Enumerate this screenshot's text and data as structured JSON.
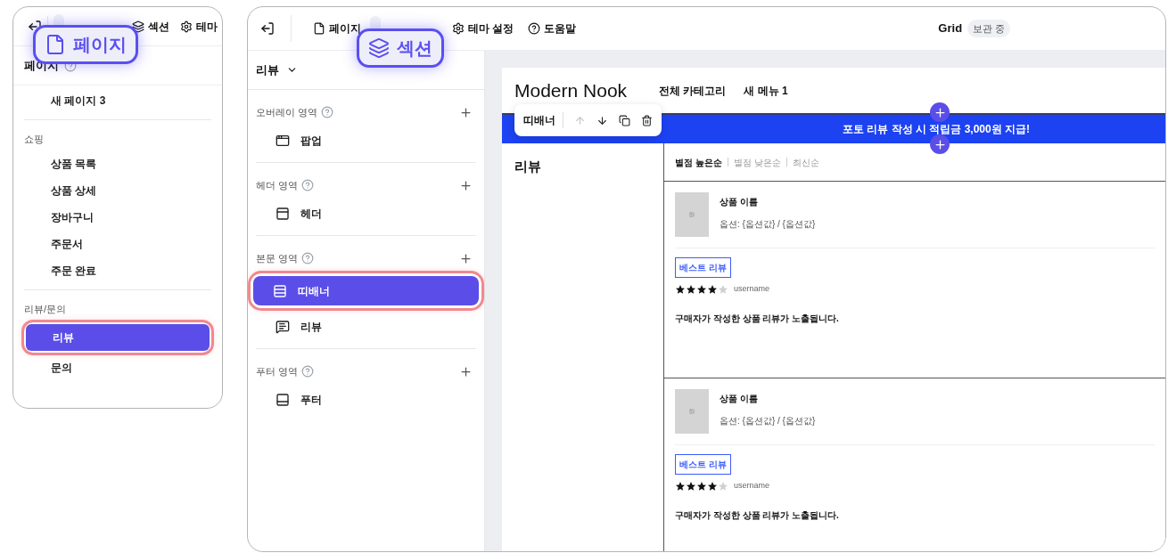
{
  "pages_panel": {
    "tabs": [
      {
        "kind": "page",
        "selected": true
      },
      {
        "label": "섹션",
        "kind": "section",
        "selected": false
      },
      {
        "label": "테마",
        "kind": "theme",
        "selected": false
      }
    ],
    "callout": {
      "label": "페이지",
      "kind": "page"
    },
    "heading": "페이지",
    "groups": [
      {
        "items": [
          {
            "label": "새 페이지 3",
            "selected": false
          }
        ]
      },
      {
        "title": "쇼핑",
        "items": [
          {
            "label": "상품 목록",
            "selected": false
          },
          {
            "label": "상품 상세",
            "selected": false
          },
          {
            "label": "장바구니",
            "selected": false
          },
          {
            "label": "주문서",
            "selected": false
          },
          {
            "label": "주문 완료",
            "selected": false
          }
        ]
      },
      {
        "title": "리뷰/문의",
        "items": [
          {
            "label": "리뷰",
            "selected": true
          },
          {
            "label": "문의",
            "selected": false
          }
        ]
      }
    ]
  },
  "editor": {
    "tabs": [
      {
        "label": "페이지",
        "kind": "page",
        "selected": false
      },
      {
        "kind": "section",
        "selected": true
      },
      {
        "label": "테마 설정",
        "kind": "theme",
        "selected": false
      },
      {
        "label": "도움말",
        "kind": "help",
        "selected": false
      }
    ],
    "callout": {
      "label": "섹션",
      "kind": "section"
    },
    "title": "Grid",
    "status": "보관 중",
    "page_select": "리뷰",
    "areas": [
      {
        "title": "오버레이 영역",
        "items": [
          {
            "label": "팝업",
            "kind": "popup",
            "selected": false
          }
        ]
      },
      {
        "title": "헤더 영역",
        "items": [
          {
            "label": "헤더",
            "kind": "header",
            "selected": false
          }
        ]
      },
      {
        "title": "본문 영역",
        "items": [
          {
            "label": "띠배너",
            "kind": "banner",
            "selected": true
          },
          {
            "label": "리뷰",
            "kind": "review",
            "selected": false
          }
        ]
      },
      {
        "title": "푸터 영역",
        "items": [
          {
            "label": "푸터",
            "kind": "footer",
            "selected": false
          }
        ]
      }
    ],
    "preview": {
      "logo": "Modern Nook",
      "menu": [
        "전체 카테고리",
        "새 메뉴 1"
      ],
      "banner": "포토 리뷰 작성 시 적립금 3,000원 지급!",
      "toolbar": {
        "label": "띠배너",
        "actions": [
          {
            "kind": "up",
            "disabled": true
          },
          {
            "kind": "down",
            "disabled": false
          },
          {
            "kind": "copy",
            "disabled": false
          },
          {
            "kind": "delete",
            "disabled": false
          }
        ]
      },
      "section_title": "리뷰",
      "sort": [
        {
          "label": "별점 높은순",
          "selected": true
        },
        {
          "label": "별점 낮은순",
          "selected": false
        },
        {
          "label": "최신순",
          "selected": false
        }
      ],
      "reviews": [
        {
          "product": "상품 이름",
          "option": "옵션: {옵션값} / {옵션값}",
          "badge": "베스트 리뷰",
          "stars": 4,
          "user": "username",
          "body": "구매자가 작성한 상품 리뷰가 노출됩니다."
        },
        {
          "product": "상품 이름",
          "option": "옵션: {옵션값} / {옵션값}",
          "badge": "베스트 리뷰",
          "stars": 4,
          "user": "username",
          "body": "구매자가 작성한 상품 리뷰가 노출됩니다."
        }
      ]
    }
  }
}
